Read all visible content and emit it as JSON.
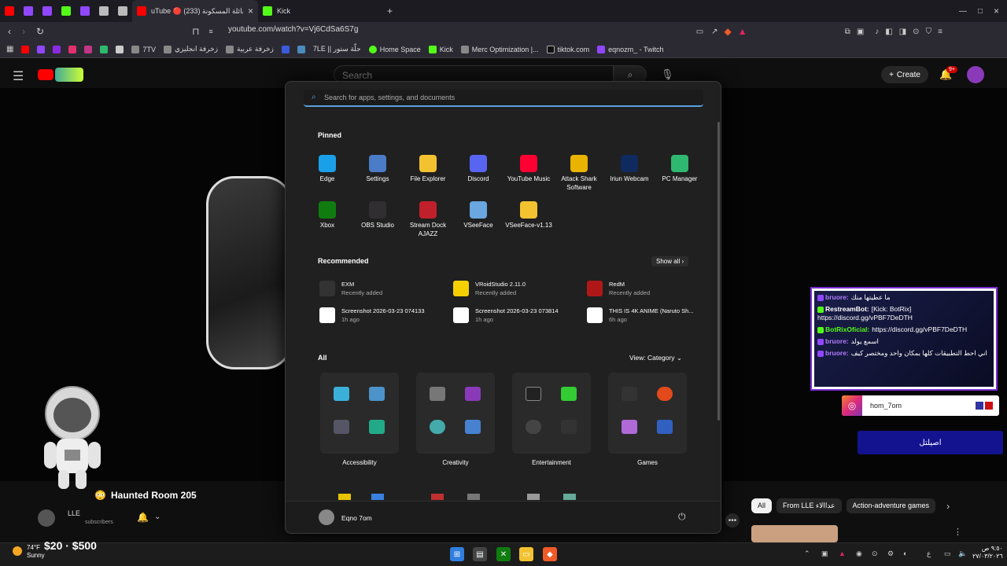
{
  "browser": {
    "tabs": [
      {
        "title": "YouTube",
        "color": "#ff0000"
      },
      {
        "title": "Twitch",
        "color": "#9147ff"
      },
      {
        "title": "Twitch",
        "color": "#9147ff"
      },
      {
        "title": "Kick",
        "color": "#53fc18"
      },
      {
        "title": "Twitch",
        "color": "#9147ff"
      },
      {
        "title": "Discord",
        "color": "#bbbbbb"
      },
      {
        "title": "Other",
        "color": "#bbbbbb"
      },
      {
        "title": "uTube 🔴 العائلة المسكونة (233)",
        "color": "#ff0000"
      },
      {
        "title": "Kick",
        "color": "#53fc18"
      }
    ],
    "url": "youtube.com/watch?v=Vj6CdSa6S7g",
    "bookmarks": [
      "7TV",
      "زخرفة انجليزي",
      "زخرفة عربية",
      "7LE || حلّة ستور",
      "Home Space",
      "Kick",
      "Merc Optimization |...",
      "tiktok.com",
      "eqnozm_ - Twitch"
    ]
  },
  "youtube": {
    "search_placeholder": "Search",
    "create_label": "Create",
    "notif_badge": "9+",
    "video_title": "Haunted Room 205",
    "channel_name": "LLE",
    "subscribers": "subscribers",
    "chips": [
      "All",
      "From LLE عداالاء",
      "Action-adventure games"
    ]
  },
  "start_menu": {
    "search_placeholder": "Search for apps, settings, and documents",
    "pinned_title": "Pinned",
    "pinned": [
      {
        "label": "Edge",
        "color": "#1aa0e8",
        "icon": "edge-icon"
      },
      {
        "label": "Settings",
        "color": "#4a7cc7",
        "icon": "gear-icon"
      },
      {
        "label": "File Explorer",
        "color": "#f2c230",
        "icon": "folder-icon"
      },
      {
        "label": "Discord",
        "color": "#5865f2",
        "icon": "discord-icon"
      },
      {
        "label": "YouTube Music",
        "color": "#ff0033",
        "icon": "youtube-music-icon"
      },
      {
        "label": "Attack Shark Software",
        "color": "#e8b400",
        "icon": "attack-shark-icon"
      },
      {
        "label": "Iriun Webcam",
        "color": "#0f2a5e",
        "icon": "webcam-icon"
      },
      {
        "label": "PC Manager",
        "color": "#2fb86f",
        "icon": "pc-manager-icon"
      },
      {
        "label": "Xbox",
        "color": "#107c10",
        "icon": "xbox-icon"
      },
      {
        "label": "OBS Studio",
        "color": "#302e31",
        "icon": "obs-icon"
      },
      {
        "label": "Stream Dock AJAZZ",
        "color": "#c0202a",
        "icon": "stream-dock-icon"
      },
      {
        "label": "VSeeFace",
        "color": "#6aa6e0",
        "icon": "vseeface-icon"
      },
      {
        "label": "VSeeFace-v1.13",
        "color": "#f2c230",
        "icon": "folder-icon"
      }
    ],
    "recommended_title": "Recommended",
    "show_all": "Show all",
    "recommended": [
      {
        "name": "EXM",
        "sub": "Recently added",
        "color": "#333333",
        "icon": "exm-icon"
      },
      {
        "name": "VRoidStudio 2.11.0",
        "sub": "Recently added",
        "color": "#f4d000",
        "icon": "vroid-icon"
      },
      {
        "name": "RedM",
        "sub": "Recently added",
        "color": "#b01818",
        "icon": "redm-icon"
      },
      {
        "name": "Screenshot 2026-03-23 074133",
        "sub": "1h ago",
        "color": "#ffffff",
        "icon": "image-file-icon"
      },
      {
        "name": "Screenshot 2026-03-23 073814",
        "sub": "1h ago",
        "color": "#ffffff",
        "icon": "image-file-icon"
      },
      {
        "name": "THIS IS 4K ANIME (Naruto Sh...",
        "sub": "6h ago",
        "color": "#ffffff",
        "icon": "video-file-icon"
      }
    ],
    "all_title": "All",
    "view_label": "View: Category",
    "categories": [
      "Accessibility",
      "Creativity",
      "Entertainment",
      "Games"
    ],
    "user_name": "Eqno 7om"
  },
  "chat": {
    "lines": [
      {
        "user": "bruore:",
        "msg": "ما عطيتها منك",
        "ucolor": "#b07cff",
        "badge": "#9147ff"
      },
      {
        "user": "RestreamBot:",
        "msg": "[Kick: BotRix] https://discord.gg/vPBF7DeDTH",
        "ucolor": "#ffffff",
        "badge": "#53fc18"
      },
      {
        "user": "BotRixOficial:",
        "msg": "https://discord.gg/vPBF7DeDTH",
        "ucolor": "#53fc18",
        "badge": "#53fc18"
      },
      {
        "user": "bruore:",
        "msg": "اسمع يولد",
        "ucolor": "#b07cff",
        "badge": "#9147ff"
      },
      {
        "user": "bruore:",
        "msg": "اني احط التطبيقات كلها بمكان واحد ومختصر كيف",
        "ucolor": "#b07cff",
        "badge": "#9147ff"
      }
    ],
    "instagram": "hom_7om",
    "badge_text": "اصيلتل"
  },
  "taskbar": {
    "temp": "74°F",
    "weather": "Sunny",
    "price": "$20 · $500",
    "time": "٩:٥٠ ص",
    "date": "٢٧/٠٣/٢٠٢٦"
  }
}
